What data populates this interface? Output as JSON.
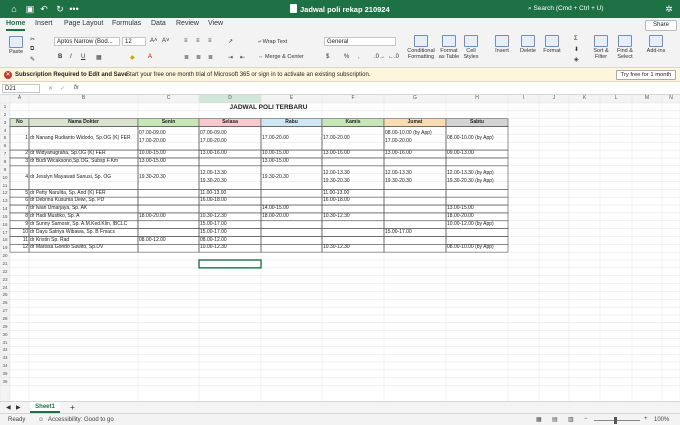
{
  "titlebar": {
    "doc_title": "Jadwal poli rekap 210924",
    "search_placeholder": "Search (Cmd + Ctrl + U)",
    "more": "•••"
  },
  "tabs": [
    "Home",
    "Insert",
    "Page Layout",
    "Formulas",
    "Data",
    "Review",
    "View"
  ],
  "share_label": "Share",
  "ribbon": {
    "paste": "Paste",
    "font_name": "Aptos Narrow (Bod...",
    "font_size": "12",
    "wrap_text": "Wrap Text",
    "merge_center": "Merge & Center",
    "number_format": "General",
    "conditional_formatting": "Conditional Formatting",
    "format_as_table": "Format as Table",
    "cell_styles": "Cell Styles",
    "insert": "Insert",
    "delete": "Delete",
    "format": "Format",
    "sort_filter": "Sort & Filter",
    "find_select": "Find & Select",
    "add_ins": "Add-ins"
  },
  "notification": {
    "bold": "Subscription Required to Edit and Save",
    "text": "Start your free one month trial of Microsoft 365 or sign in to activate an existing subscription.",
    "button": "Try free for 1 month"
  },
  "formula_bar": {
    "name_box": "D21",
    "fx": "fx",
    "value": ""
  },
  "columns": [
    "A",
    "B",
    "C",
    "D",
    "E",
    "F",
    "G",
    "H",
    "I",
    "J",
    "K",
    "L",
    "M",
    "N"
  ],
  "rows": [
    "1",
    "2",
    "3",
    "4",
    "5",
    "6",
    "7",
    "8",
    "9",
    "10",
    "11",
    "12",
    "13",
    "14",
    "15",
    "16",
    "17",
    "18",
    "19",
    "20",
    "21",
    "22",
    "23",
    "24",
    "25",
    "26",
    "27",
    "28",
    "29",
    "30",
    "31",
    "32",
    "33",
    "34",
    "35",
    "36"
  ],
  "sheet": {
    "title": "JADWAL POLI TERBARU",
    "headers": [
      "No",
      "Nama Dokter",
      "Senin",
      "Selasa",
      "Rabu",
      "Kamis",
      "Jumat",
      "Sabtu"
    ],
    "header_colors": [
      "#d8e4d0",
      "#d8e4d0",
      "#c7e7b7",
      "#f7c9cf",
      "#cfe6f5",
      "#c7e7b7",
      "#f8ddb3",
      "#d3d3d3"
    ],
    "doctors": [
      {
        "no": "1",
        "name": "dr Nanang Rudianto Widodo, Sp.OG (K) FER",
        "senin": [
          "07.00-09.00",
          "17.00-20.00"
        ],
        "selasa": [
          "07.00-09.00",
          "17.00-20.00"
        ],
        "rabu": [
          "17.00-20.00"
        ],
        "kamis": [
          "17.00-20.00"
        ],
        "jumat": [
          "08.00-10.00 (by App)",
          "17.00-20.00"
        ],
        "sabtu": [
          "08.00-10.00 (by App)"
        ]
      },
      {
        "no": "2",
        "name": "dr Widyanugraha, Sp.OG (K) FER",
        "senin": [
          "10.00-15.00"
        ],
        "selasa": [
          "13.00-16.00"
        ],
        "rabu": [
          "10.00-15.00"
        ],
        "kamis": [
          "13.00-16.00"
        ],
        "jumat": [
          "13.00-16.00"
        ],
        "sabtu": [
          "09.00-13.00"
        ]
      },
      {
        "no": "3",
        "name": "dr Budi Wicaksono,Sp.OG, Subsp.F.Km",
        "senin": [
          "13.00-15.00"
        ],
        "selasa": [],
        "rabu": [
          "13.00-15.00"
        ],
        "kamis": [],
        "jumat": [],
        "sabtu": []
      },
      {
        "no": "4",
        "name": "dr Jesslyn Mayawati Sanusi, Sp. OG",
        "senin": [
          "19.30-20.30"
        ],
        "selasa": [
          "12.00-13.30",
          "19.30-20.30"
        ],
        "rabu": [
          "19.30-20.30"
        ],
        "kamis": [
          "12.00-13.30",
          "19.30-20.30"
        ],
        "jumat": [
          "12.00-13.30",
          "19.30-20.30"
        ],
        "sabtu": [
          "12.00-13.30 (by App)",
          "19.30-20.30 (by App)"
        ]
      },
      {
        "no": "5",
        "name": "dr Petty Narulita, Sp. And (K) FER",
        "senin": [],
        "selasa": [
          "11.00-13.00"
        ],
        "rabu": [],
        "kamis": [
          "11.00-13.00"
        ],
        "jumat": [],
        "sabtu": []
      },
      {
        "no": "6",
        "name": "dr Debrina Kusuma Dewi, Sp. PD",
        "senin": [],
        "selasa": [
          "16.00-18.00"
        ],
        "rabu": [],
        "kamis": [
          "16.00-18.00"
        ],
        "jumat": [],
        "sabtu": []
      },
      {
        "no": "7",
        "name": "dr Iwan Umarjaya, Sp. AK",
        "senin": [],
        "selasa": [],
        "rabu": [
          "14.00-15.00"
        ],
        "kamis": [],
        "jumat": [],
        "sabtu": [
          "13.00-15.00"
        ]
      },
      {
        "no": "8",
        "name": "dr Hadi Mustiko, Sp. A",
        "senin": [
          "18.00-20.00"
        ],
        "selasa": [
          "10.30-12.30"
        ],
        "rabu": [
          "18.00-20.00"
        ],
        "kamis": [
          "10.30-12.30"
        ],
        "jumat": [],
        "sabtu": [
          "18.00-20.00"
        ]
      },
      {
        "no": "9",
        "name": "dr Sunny Samosir, Sp. A.M.Ked.Klin, IBCLC",
        "senin": [],
        "selasa": [
          "15.00-17.00"
        ],
        "rabu": [],
        "kamis": [],
        "jumat": [],
        "sabtu": [
          "10.00-12.00 (by App)"
        ]
      },
      {
        "no": "10",
        "name": "dr Dayu Satriya Wibawa, Sp. B Fmacs",
        "senin": [],
        "selasa": [
          "15.00-17.00"
        ],
        "rabu": [],
        "kamis": [],
        "jumat": [
          "15.00-17.00"
        ],
        "sabtu": []
      },
      {
        "no": "11",
        "name": "dr Kristin Sp. Rad",
        "senin": [
          "08.00-12.00"
        ],
        "selasa": [
          "08.00-12.00"
        ],
        "rabu": [],
        "kamis": [],
        "jumat": [],
        "sabtu": []
      },
      {
        "no": "12",
        "name": "dr Marissa Gondo Suwito, Sp.DV",
        "senin": [],
        "selasa": [
          "10.00-12.30"
        ],
        "rabu": [],
        "kamis": [
          "10.30-12.30"
        ],
        "jumat": [],
        "sabtu": [
          "08.00-10.00 (by App)"
        ]
      }
    ]
  },
  "sheet_tab": "Sheet1",
  "status": {
    "ready": "Ready",
    "accessibility": "Accessibility: Good to go",
    "zoom": "100%"
  },
  "accent_color": "#1e7145"
}
